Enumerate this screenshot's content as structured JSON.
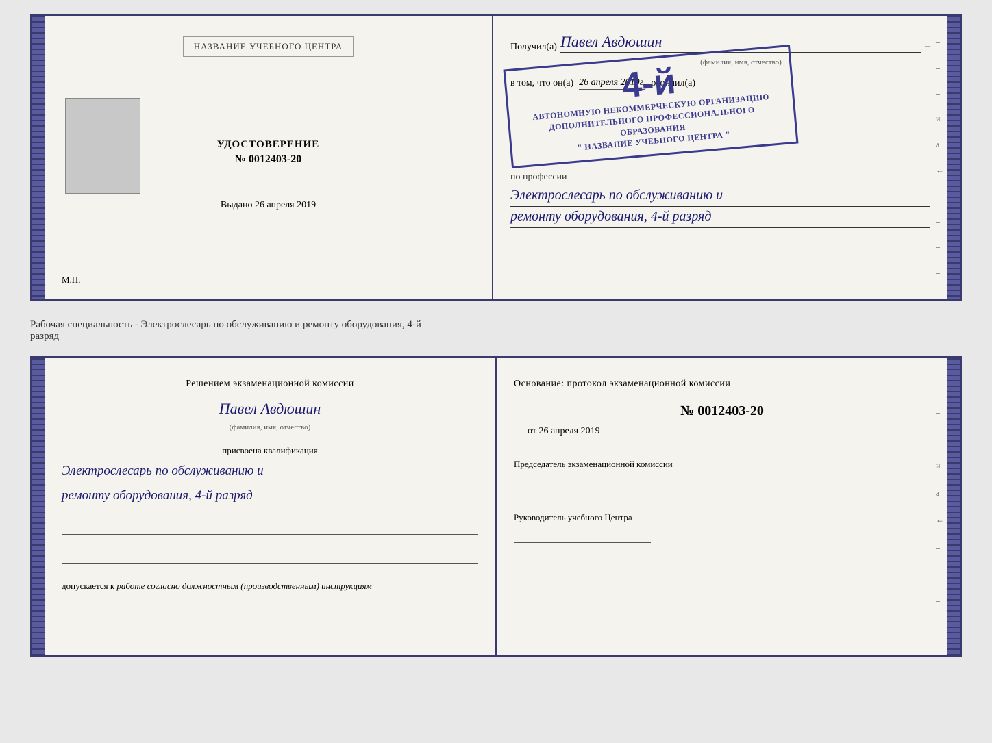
{
  "top_document": {
    "left_page": {
      "center_label": "НАЗВАНИЕ УЧЕБНОГО ЦЕНТРА",
      "cert_type": "УДОСТОВЕРЕНИЕ",
      "cert_number": "№ 0012403-20",
      "issued_label": "Выдано",
      "issued_date": "26 апреля 2019",
      "mp_label": "М.П."
    },
    "right_page": {
      "received_prefix": "Получил(а)",
      "received_name": "Павел Авдюшин",
      "fio_subtitle": "(фамилия, имя, отчество)",
      "dash": "–",
      "vtom_prefix": "в том, что он(а)",
      "vtom_date": "26 апреля 2019г.",
      "vtom_suffix": "окончил(а)",
      "stamp_number": "4-й",
      "stamp_line1": "АВТОНОМНУЮ НЕКОММЕРЧЕСКУЮ ОРГАНИЗАЦИЮ",
      "stamp_line2": "ДОПОЛНИТЕЛЬНОГО ПРОФЕССИОНАЛЬНОГО ОБРАЗОВАНИЯ",
      "stamp_line3": "\" НАЗВАНИЕ УЧЕБНОГО ЦЕНТРА \"",
      "profession_label": "по профессии",
      "profession_value": "Электрослесарь по обслуживанию и",
      "profession_value2": "ремонту оборудования, 4-й разряд",
      "right_dashes": [
        "–",
        "–",
        "–",
        "и",
        "а",
        "←",
        "–",
        "–",
        "–",
        "–"
      ]
    }
  },
  "specialty_line": {
    "text": "Рабочая специальность - Электрослесарь по обслуживанию и ремонту оборудования, 4-й",
    "text2": "разряд"
  },
  "bottom_document": {
    "left_page": {
      "commission_title": "Решением экзаменационной комиссии",
      "person_name": "Павел Авдюшин",
      "fio_subtitle": "(фамилия, имя, отчество)",
      "assigned_label": "присвоена квалификация",
      "qualification_line1": "Электрослесарь по обслуживанию и",
      "qualification_line2": "ремонту оборудования, 4-й разряд",
      "допускается_prefix": "допускается к",
      "допускается_text": "работе согласно должностным (производственным) инструкциям"
    },
    "right_page": {
      "osnov_text": "Основание: протокол экзаменационной комиссии",
      "protocol_number": "№ 0012403-20",
      "date_prefix": "от",
      "date_value": "26 апреля 2019",
      "chairman_label": "Председатель экзаменационной комиссии",
      "head_label": "Руководитель учебного Центра",
      "right_dashes": [
        "–",
        "–",
        "–",
        "и",
        "а",
        "←",
        "–",
        "–",
        "–",
        "–"
      ]
    }
  }
}
